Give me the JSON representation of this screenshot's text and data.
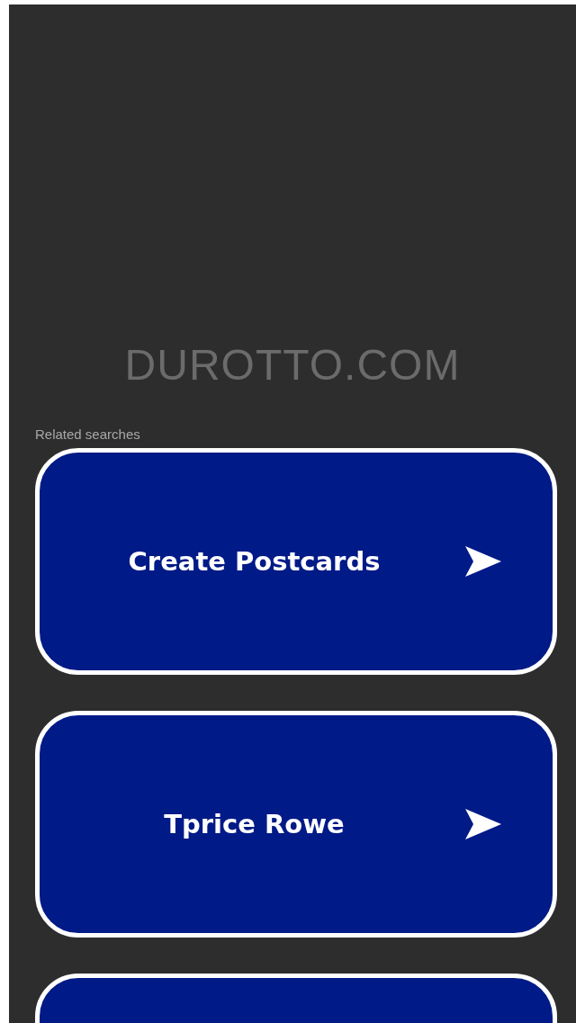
{
  "site_title": "DUROTTO.COM",
  "related": {
    "heading": "Related searches",
    "items": [
      {
        "label": "Create Postcards"
      },
      {
        "label": "Tprice Rowe"
      }
    ],
    "more_below": true
  }
}
